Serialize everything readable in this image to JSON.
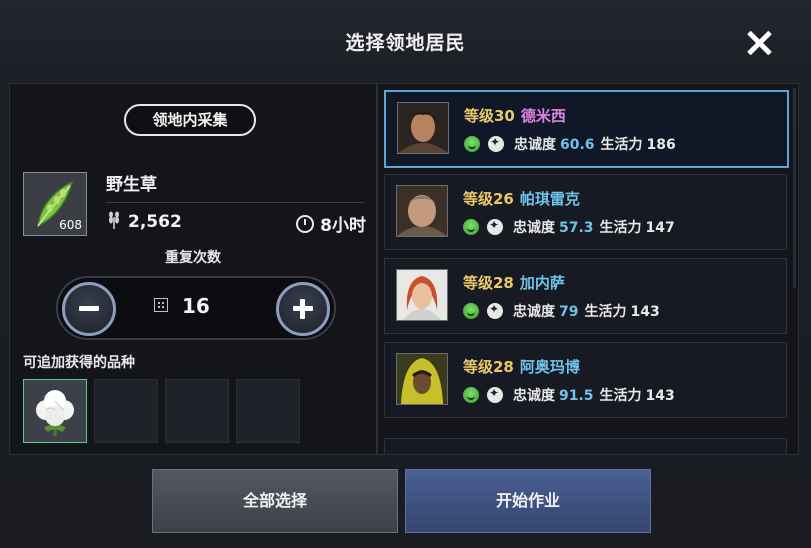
{
  "dialog": {
    "title": "选择领地居民"
  },
  "left": {
    "mode_label": "领地内采集",
    "item": {
      "icon": "leaf-icon",
      "quantity": "608",
      "name": "野生草",
      "yield": "2,562",
      "time": "8小时"
    },
    "repeat": {
      "label": "重复次数",
      "value": "16"
    },
    "extra_label": "可追加获得的品种",
    "extra_slots": [
      {
        "icon": "cotton-icon",
        "filled": true
      },
      {
        "filled": false
      },
      {
        "filled": false
      },
      {
        "filled": false
      }
    ]
  },
  "residents": [
    {
      "level": "等级30",
      "name": "德米西",
      "name_color": "#e082e6",
      "loyalty_label": "忠诚度",
      "loyalty": "60.6",
      "vitality_label": "生活力",
      "vitality": "186",
      "selected": true
    },
    {
      "level": "等级26",
      "name": "帕琪雷克",
      "name_color": "#6fc3e8",
      "loyalty_label": "忠诚度",
      "loyalty": "57.3",
      "vitality_label": "生活力",
      "vitality": "147",
      "selected": false
    },
    {
      "level": "等级28",
      "name": "加内萨",
      "name_color": "#6fc3e8",
      "loyalty_label": "忠诚度",
      "loyalty": "79",
      "vitality_label": "生活力",
      "vitality": "143",
      "selected": false
    },
    {
      "level": "等级28",
      "name": "阿奥玛博",
      "name_color": "#6fc3e8",
      "loyalty_label": "忠诚度",
      "loyalty": "91.5",
      "vitality_label": "生活力",
      "vitality": "143",
      "selected": false
    }
  ],
  "buttons": {
    "select_all": "全部选择",
    "start": "开始作业"
  }
}
